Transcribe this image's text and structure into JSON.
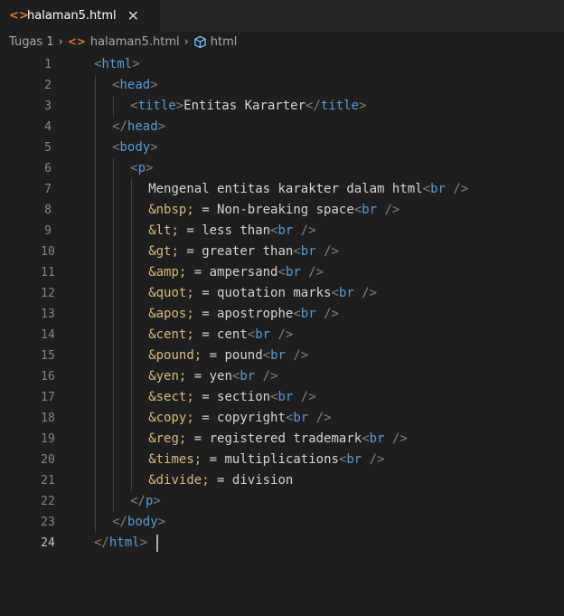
{
  "tab": {
    "icon": "html-file-icon",
    "label": "halaman5.html",
    "close_glyph": "✕"
  },
  "breadcrumb": {
    "folder": "Tugas 1",
    "file": "halaman5.html",
    "symbol": "html",
    "separator": "›"
  },
  "colors": {
    "background": "#1e1e1e",
    "tag": "#569cd6",
    "bracket": "#808080",
    "entity": "#d7ba7d",
    "text": "#d4d4d4",
    "line_number": "#858585",
    "file_icon": "#e37933"
  },
  "editor": {
    "active_line": 24,
    "lines": [
      {
        "n": "1",
        "parts": [
          [
            "b",
            "<"
          ],
          [
            "t",
            "html"
          ],
          [
            "b",
            ">"
          ]
        ]
      },
      {
        "n": "2",
        "parts": [
          [
            "b",
            "<"
          ],
          [
            "t",
            "head"
          ],
          [
            "b",
            ">"
          ]
        ]
      },
      {
        "n": "3",
        "parts": [
          [
            "b",
            "<"
          ],
          [
            "t",
            "title"
          ],
          [
            "b",
            ">"
          ],
          [
            "x",
            "Entitas Kararter"
          ],
          [
            "b",
            "</"
          ],
          [
            "t",
            "title"
          ],
          [
            "b",
            ">"
          ]
        ]
      },
      {
        "n": "4",
        "parts": [
          [
            "b",
            "</"
          ],
          [
            "t",
            "head"
          ],
          [
            "b",
            ">"
          ]
        ]
      },
      {
        "n": "5",
        "parts": [
          [
            "b",
            "<"
          ],
          [
            "t",
            "body"
          ],
          [
            "b",
            ">"
          ]
        ]
      },
      {
        "n": "6",
        "parts": [
          [
            "b",
            "<"
          ],
          [
            "t",
            "p"
          ],
          [
            "b",
            ">"
          ]
        ]
      },
      {
        "n": "7",
        "parts": [
          [
            "x",
            "Mengenal entitas karakter dalam html"
          ],
          [
            "b",
            "<"
          ],
          [
            "t",
            "br"
          ],
          [
            "b",
            " />"
          ]
        ]
      },
      {
        "n": "8",
        "parts": [
          [
            "e",
            "&nbsp;"
          ],
          [
            "x",
            " = Non-breaking space"
          ],
          [
            "b",
            "<"
          ],
          [
            "t",
            "br"
          ],
          [
            "b",
            " />"
          ]
        ]
      },
      {
        "n": "9",
        "parts": [
          [
            "e",
            "&lt;"
          ],
          [
            "x",
            " = less than"
          ],
          [
            "b",
            "<"
          ],
          [
            "t",
            "br"
          ],
          [
            "b",
            " />"
          ]
        ]
      },
      {
        "n": "10",
        "parts": [
          [
            "e",
            "&gt;"
          ],
          [
            "x",
            " = greater than"
          ],
          [
            "b",
            "<"
          ],
          [
            "t",
            "br"
          ],
          [
            "b",
            " />"
          ]
        ]
      },
      {
        "n": "11",
        "parts": [
          [
            "e",
            "&amp;"
          ],
          [
            "x",
            " = ampersand"
          ],
          [
            "b",
            "<"
          ],
          [
            "t",
            "br"
          ],
          [
            "b",
            " />"
          ]
        ]
      },
      {
        "n": "12",
        "parts": [
          [
            "e",
            "&quot;"
          ],
          [
            "x",
            " = quotation marks"
          ],
          [
            "b",
            "<"
          ],
          [
            "t",
            "br"
          ],
          [
            "b",
            " />"
          ]
        ]
      },
      {
        "n": "13",
        "parts": [
          [
            "e",
            "&apos;"
          ],
          [
            "x",
            " = apostrophe"
          ],
          [
            "b",
            "<"
          ],
          [
            "t",
            "br"
          ],
          [
            "b",
            " />"
          ]
        ]
      },
      {
        "n": "14",
        "parts": [
          [
            "e",
            "&cent;"
          ],
          [
            "x",
            " = cent"
          ],
          [
            "b",
            "<"
          ],
          [
            "t",
            "br"
          ],
          [
            "b",
            " />"
          ]
        ]
      },
      {
        "n": "15",
        "parts": [
          [
            "e",
            "&pound;"
          ],
          [
            "x",
            " = pound"
          ],
          [
            "b",
            "<"
          ],
          [
            "t",
            "br"
          ],
          [
            "b",
            " />"
          ]
        ]
      },
      {
        "n": "16",
        "parts": [
          [
            "e",
            "&yen;"
          ],
          [
            "x",
            " = yen"
          ],
          [
            "b",
            "<"
          ],
          [
            "t",
            "br"
          ],
          [
            "b",
            " />"
          ]
        ]
      },
      {
        "n": "17",
        "parts": [
          [
            "e",
            "&sect;"
          ],
          [
            "x",
            " = section"
          ],
          [
            "b",
            "<"
          ],
          [
            "t",
            "br"
          ],
          [
            "b",
            " />"
          ]
        ]
      },
      {
        "n": "18",
        "parts": [
          [
            "e",
            "&copy;"
          ],
          [
            "x",
            " = copyright"
          ],
          [
            "b",
            "<"
          ],
          [
            "t",
            "br"
          ],
          [
            "b",
            " />"
          ]
        ]
      },
      {
        "n": "19",
        "parts": [
          [
            "e",
            "&reg;"
          ],
          [
            "x",
            " = registered trademark"
          ],
          [
            "b",
            "<"
          ],
          [
            "t",
            "br"
          ],
          [
            "b",
            " />"
          ]
        ]
      },
      {
        "n": "20",
        "parts": [
          [
            "e",
            "&times;"
          ],
          [
            "x",
            " = multiplications"
          ],
          [
            "b",
            "<"
          ],
          [
            "t",
            "br"
          ],
          [
            "b",
            " />"
          ]
        ]
      },
      {
        "n": "21",
        "parts": [
          [
            "e",
            "&divide;"
          ],
          [
            "x",
            " = division"
          ]
        ]
      },
      {
        "n": "22",
        "parts": [
          [
            "b",
            "</"
          ],
          [
            "t",
            "p"
          ],
          [
            "b",
            ">"
          ]
        ]
      },
      {
        "n": "23",
        "parts": [
          [
            "b",
            "</"
          ],
          [
            "t",
            "body"
          ],
          [
            "b",
            ">"
          ]
        ]
      },
      {
        "n": "24",
        "parts": [
          [
            "b",
            "</"
          ],
          [
            "t",
            "html"
          ],
          [
            "b",
            ">"
          ]
        ]
      }
    ]
  }
}
